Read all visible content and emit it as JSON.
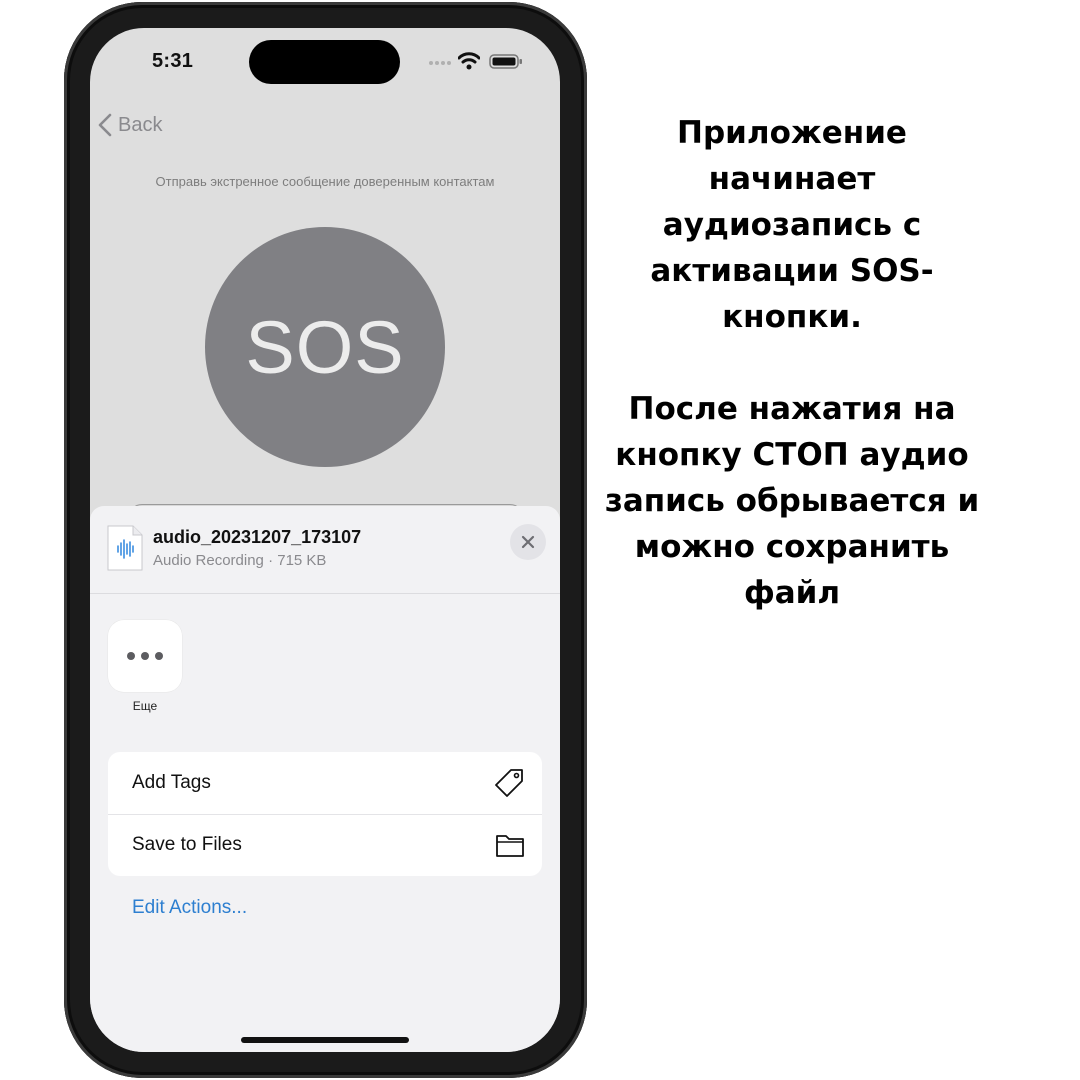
{
  "status_bar": {
    "time": "5:31"
  },
  "nav": {
    "back_label": "Back"
  },
  "screen": {
    "subtitle": "Отправь экстренное сообщение доверенным контактам",
    "sos_label": "SOS"
  },
  "share_sheet": {
    "file_name": "audio_20231207_173107",
    "file_meta": "Audio Recording · 715 KB",
    "more_label": "Еще",
    "actions": [
      {
        "label": "Add Tags",
        "icon": "tag-icon"
      },
      {
        "label": "Save to Files",
        "icon": "folder-icon"
      }
    ],
    "edit_actions_label": "Edit Actions..."
  },
  "caption": {
    "paragraph_1": "Приложение начинает аудиозапись с активации SOS-кнопки.",
    "paragraph_2": "После нажатия на кнопку СТОП аудио запись обрывается и можно сохранить файл"
  },
  "colors": {
    "sos_circle": "#808084",
    "link": "#2d7fd0",
    "waveform": "#3a8ddf"
  }
}
